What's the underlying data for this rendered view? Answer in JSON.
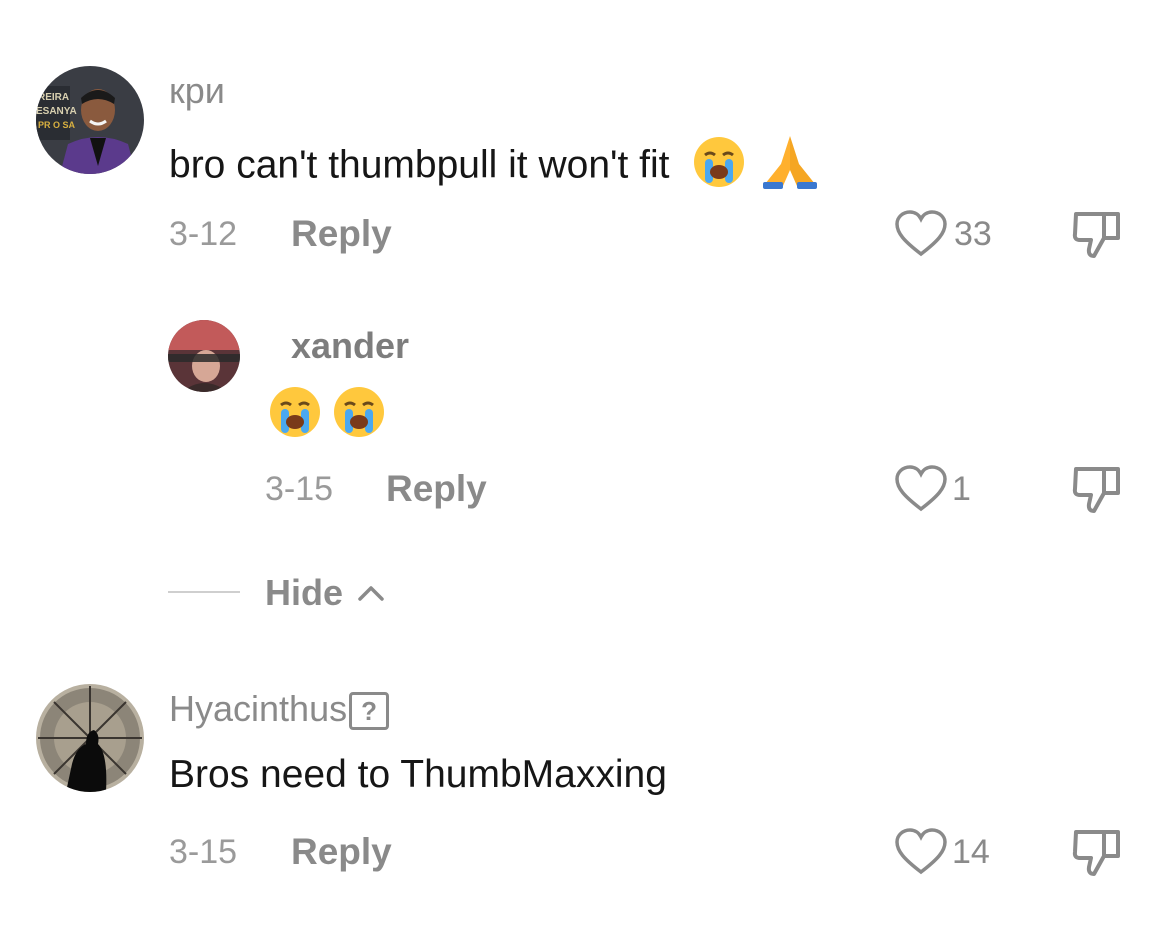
{
  "comments": [
    {
      "username": "кри",
      "text": "bro can't thumbpull it won't fit",
      "emojis": [
        "loudly-crying-face",
        "folded-hands"
      ],
      "date": "3-12",
      "reply_label": "Reply",
      "likes": "33",
      "avatar_text": [
        "REIRA",
        "ESANYA",
        "PR O SA"
      ]
    },
    {
      "username": "xander",
      "text": "",
      "emojis": [
        "loudly-crying-face",
        "loudly-crying-face"
      ],
      "date": "3-15",
      "reply_label": "Reply",
      "likes": "1"
    },
    {
      "username": "Hyacinthus",
      "username_badge": "?",
      "text": "Bros need to ThumbMaxxing",
      "date": "3-15",
      "reply_label": "Reply",
      "likes": "14"
    }
  ],
  "hide_label": "Hide",
  "colors": {
    "text": "#161616",
    "muted": "#8a8a8a",
    "date": "#9a9a9a",
    "background": "#ffffff"
  }
}
